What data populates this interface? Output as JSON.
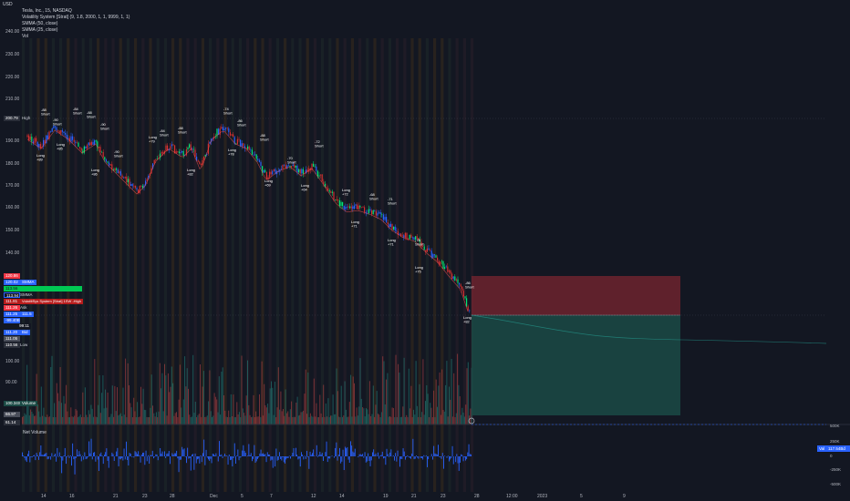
{
  "header": {
    "currency": "USD",
    "series_title": "Tesla, Inc., 15, NASDAQ",
    "indicators": [
      "Volatility System [Strat] (9, 1.8, 2000, 1, 1, 9999, 1, 1)",
      "SMMA (50, close)",
      "SMMA (25, close)",
      "Vol"
    ]
  },
  "price_axis": [
    "240.00",
    "230.00",
    "220.00",
    "210.00",
    "200.00",
    "190.00",
    "180.00",
    "170.00",
    "160.00",
    "150.00",
    "140.00",
    "130.00",
    "120.00",
    "110.00",
    "100.00",
    "90.00"
  ],
  "labels": {
    "high_value": "200.79",
    "high_text": "High",
    "smma_value": "120.86",
    "smma2_value": "120.02",
    "smma2_text": "SMMA",
    "green_value": "113.56",
    "smma3_value": "113.94",
    "smma3_text": "SMMA",
    "strat_value": "111.81",
    "strat_text": "VolatiliSys System [Strat] 1SW -High",
    "ask_value": "111.26",
    "ask_text": "Ask",
    "close_value": "111.25",
    "close_tag": "111.5",
    "diff_value": "-99.40B",
    "diff2": "99:11",
    "bid_value": "111.20",
    "bid_text": "Bid",
    "bid2_value": "111.05",
    "low_value": "110.56",
    "low_text": "Low",
    "vol_value": "100.34SM",
    "vol_text": "Volume",
    "vol2_value": "66.97",
    "vol3_value": "61.14"
  },
  "time_axis": [
    "14",
    "16",
    "21",
    "23",
    "28",
    "Dec",
    "5",
    "7",
    "12",
    "14",
    "19",
    "21",
    "23",
    "28",
    "12:00",
    "2023",
    "5",
    "9"
  ],
  "volume_axis": {
    "top": "500K"
  },
  "net_volume": {
    "title": "Net Volume",
    "axis": [
      "250K",
      "0",
      "-250K",
      "-500K"
    ],
    "tag_text": "Val",
    "tag_value": "117.54Bd"
  },
  "trade_labels": [
    {
      "text": "-88 Short"
    },
    {
      "text": "-90 Short"
    },
    {
      "text": "-84 Short"
    },
    {
      "text": "Long +89"
    },
    {
      "text": "Long +85"
    },
    {
      "text": "-88 Short"
    },
    {
      "text": "-90 Short"
    },
    {
      "text": "Long +86"
    },
    {
      "text": "-90 Short"
    },
    {
      "text": "Long +79"
    },
    {
      "text": "-84 Short"
    },
    {
      "text": "-88 Short"
    },
    {
      "text": "Long +82"
    },
    {
      "text": "-74 Short"
    },
    {
      "text": "-86 Short"
    },
    {
      "text": "Long +78"
    },
    {
      "text": "-88 Short"
    },
    {
      "text": "Long +69"
    },
    {
      "text": "-70 Short"
    },
    {
      "text": "Long +64"
    },
    {
      "text": "-72 Short"
    },
    {
      "text": "Long +72"
    },
    {
      "text": "-68 Short"
    },
    {
      "text": "Long +71"
    },
    {
      "text": "-71 Short"
    },
    {
      "text": "Long +71"
    },
    {
      "text": "-78 Short"
    },
    {
      "text": "Long +75"
    },
    {
      "text": "-86 Short"
    },
    {
      "text": "Long +82"
    }
  ],
  "colors": {
    "bg": "#131722",
    "up": "#26a69a",
    "down": "#ef5350",
    "blue": "#2962ff",
    "green_candle": "#00e676",
    "red_candle": "#d32f2f",
    "stop_zone": "#7a2630",
    "profit_zone": "#1b4a45"
  }
}
